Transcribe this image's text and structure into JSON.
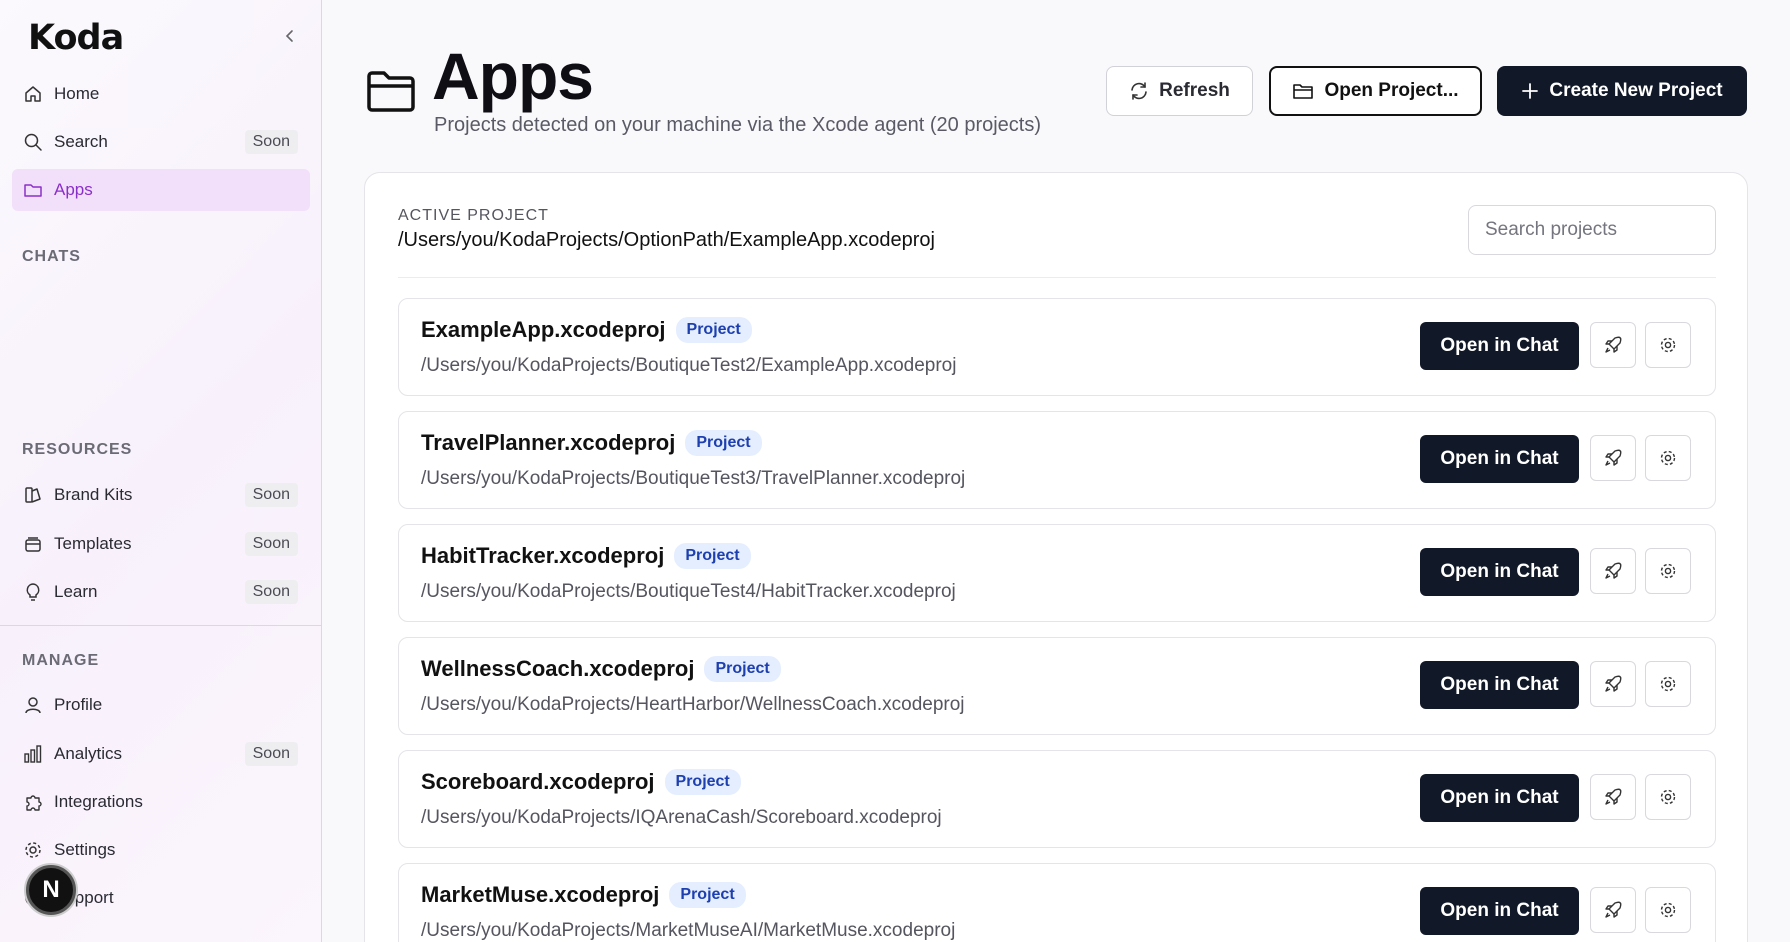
{
  "sidebar": {
    "logo": "Koda",
    "nav": [
      {
        "label": "Home",
        "icon": "home-icon",
        "soon": ""
      },
      {
        "label": "Search",
        "icon": "search-icon",
        "soon": "Soon"
      },
      {
        "label": "Apps",
        "icon": "folder-icon",
        "soon": "",
        "active": true
      }
    ],
    "chats_title": "CHATS",
    "resources_title": "RESOURCES",
    "resources": [
      {
        "label": "Brand Kits",
        "icon": "brand-kit-icon",
        "soon": "Soon"
      },
      {
        "label": "Templates",
        "icon": "templates-icon",
        "soon": "Soon"
      },
      {
        "label": "Learn",
        "icon": "lightbulb-icon",
        "soon": "Soon"
      }
    ],
    "manage_title": "MANAGE",
    "manage": [
      {
        "label": "Profile",
        "icon": "user-icon",
        "soon": ""
      },
      {
        "label": "Analytics",
        "icon": "bar-chart-icon",
        "soon": "Soon"
      },
      {
        "label": "Integrations",
        "icon": "puzzle-icon",
        "soon": ""
      },
      {
        "label": "Settings",
        "icon": "gear-icon",
        "soon": ""
      },
      {
        "label": "Support",
        "icon": "help-icon",
        "soon": ""
      }
    ],
    "avatar_letter": "N"
  },
  "header": {
    "title": "Apps",
    "subtitle": "Projects detected on your machine via the Xcode agent (20 projects)",
    "refresh_label": "Refresh",
    "open_label": "Open Project...",
    "create_label": "Create New Project"
  },
  "active_project": {
    "label": "ACTIVE PROJECT",
    "path": "/Users/you/KodaProjects/OptionPath/ExampleApp.xcodeproj"
  },
  "search": {
    "placeholder": "Search projects"
  },
  "project_badge": "Project",
  "open_chat_label": "Open in Chat",
  "projects": [
    {
      "name": "ExampleApp.xcodeproj",
      "path": "/Users/you/KodaProjects/BoutiqueTest2/ExampleApp.xcodeproj"
    },
    {
      "name": "TravelPlanner.xcodeproj",
      "path": "/Users/you/KodaProjects/BoutiqueTest3/TravelPlanner.xcodeproj"
    },
    {
      "name": "HabitTracker.xcodeproj",
      "path": "/Users/you/KodaProjects/BoutiqueTest4/HabitTracker.xcodeproj"
    },
    {
      "name": "WellnessCoach.xcodeproj",
      "path": "/Users/you/KodaProjects/HeartHarbor/WellnessCoach.xcodeproj"
    },
    {
      "name": "Scoreboard.xcodeproj",
      "path": "/Users/you/KodaProjects/IQArenaCash/Scoreboard.xcodeproj"
    },
    {
      "name": "MarketMuse.xcodeproj",
      "path": "/Users/you/KodaProjects/MarketMuseAI/MarketMuse.xcodeproj"
    }
  ],
  "colors": {
    "accent": "#8b2fc9",
    "primary": "#111827",
    "badge": "#1e40af"
  }
}
